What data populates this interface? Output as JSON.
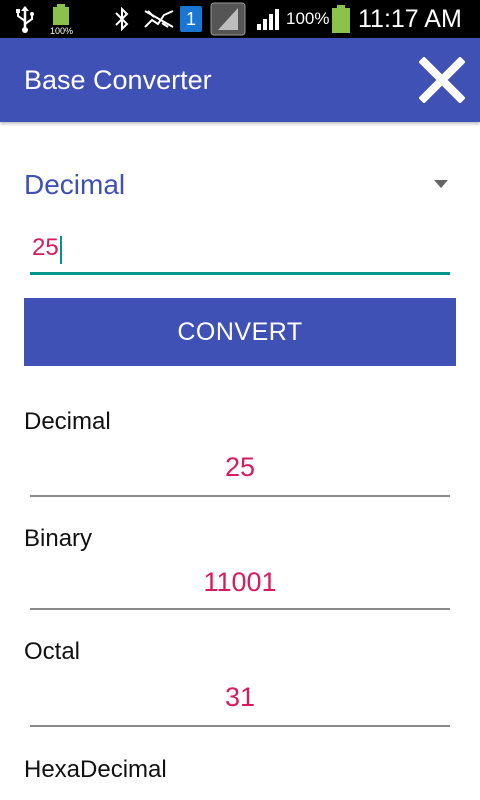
{
  "status_bar": {
    "battery_left_percent": "100%",
    "notification_badge": "1",
    "battery_percent": "100%",
    "time": "11:17 AM"
  },
  "app_bar": {
    "title": "Base Converter",
    "close_icon": "close-icon"
  },
  "form": {
    "base_selected": "Decimal",
    "input_value": "25",
    "convert_label": "CONVERT"
  },
  "results": [
    {
      "label": "Decimal",
      "value": "25"
    },
    {
      "label": "Binary",
      "value": "11001"
    },
    {
      "label": "Octal",
      "value": "31"
    },
    {
      "label": "HexaDecimal",
      "value": ""
    }
  ],
  "colors": {
    "primary": "#3f51b5",
    "accent": "#d81b60",
    "input_underline": "#009688"
  }
}
